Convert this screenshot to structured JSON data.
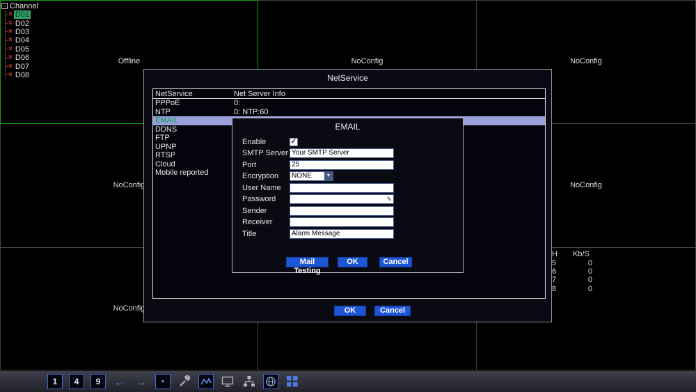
{
  "channel_panel": {
    "title": "Channel",
    "items": [
      "D01",
      "D02",
      "D03",
      "D04",
      "D05",
      "D06",
      "D07",
      "D08"
    ],
    "selected_item": "D01"
  },
  "video_grid": {
    "cells": [
      "Offline",
      "NoConfig",
      "NoConfig",
      "NoConfig",
      "NoConfig",
      "NoConfig",
      "NoConfig",
      "NoConfig",
      ""
    ],
    "selected_cell_index": 0
  },
  "bitrate_panel": {
    "headers": [
      "H",
      "Kb/S"
    ],
    "rows": [
      [
        "5",
        "0"
      ],
      [
        "6",
        "0"
      ],
      [
        "7",
        "0"
      ],
      [
        "8",
        "0"
      ]
    ]
  },
  "netservice_dialog": {
    "title": "NetService",
    "columns": [
      "NetService",
      "Net Server Info"
    ],
    "rows": [
      {
        "name": "PPPoE",
        "info": "0:"
      },
      {
        "name": "NTP",
        "info": "0: NTP:60"
      },
      {
        "name": "EMAIL",
        "info": ""
      },
      {
        "name": "DDNS",
        "info": ""
      },
      {
        "name": "FTP",
        "info": ""
      },
      {
        "name": "UPNP",
        "info": ""
      },
      {
        "name": "RTSP",
        "info": ""
      },
      {
        "name": "Cloud",
        "info": ""
      },
      {
        "name": "Mobile reported",
        "info": ""
      }
    ],
    "selected_row": "EMAIL",
    "ok_button": "OK",
    "cancel_button": "Cancel"
  },
  "email_dialog": {
    "title": "EMAIL",
    "enable_label": "Enable",
    "enable_checked": true,
    "smtp_label": "SMTP Server",
    "smtp_value": "Your SMTP Server",
    "port_label": "Port",
    "port_value": "25",
    "encryption_label": "Encryption",
    "encryption_value": "NONE",
    "username_label": "User Name",
    "username_value": "",
    "password_label": "Password",
    "password_value": "",
    "sender_label": "Sender",
    "sender_value": "",
    "receiver_label": "Receiver",
    "receiver_value": "",
    "title_label": "Title",
    "title_value": "Alarm Message",
    "mail_testing_button": "Mail Testing",
    "ok_button": "OK",
    "cancel_button": "Cancel"
  },
  "toolbar": {
    "icons": [
      {
        "name": "single-window",
        "glyph": "1"
      },
      {
        "name": "quad-window",
        "glyph": "4"
      },
      {
        "name": "nine-window",
        "glyph": "9"
      },
      {
        "name": "previous-channel",
        "glyph": "←"
      },
      {
        "name": "next-channel",
        "glyph": "→"
      },
      {
        "name": "single-view",
        "glyph": "▪"
      },
      {
        "name": "ptz-control"
      },
      {
        "name": "color-setting"
      },
      {
        "name": "output-adjust"
      },
      {
        "name": "network-setting"
      },
      {
        "name": "web-setting"
      },
      {
        "name": "multi-preview"
      }
    ]
  },
  "icons": {
    "check": "✓",
    "dropdown_arrow": "▼",
    "offline_mark": "×",
    "tree_collapse": "-",
    "password_edit": "✎"
  },
  "colors": {
    "button_blue": "#1d55d4",
    "selected_row_lavender": "#9aa0dc",
    "selected_service_green": "#009c46",
    "selected_cell_border_green": "#18a018",
    "channel_highlight_teal": "#2fa06a",
    "offline_mark_red": "#e03030",
    "input_border": "#46598c"
  }
}
